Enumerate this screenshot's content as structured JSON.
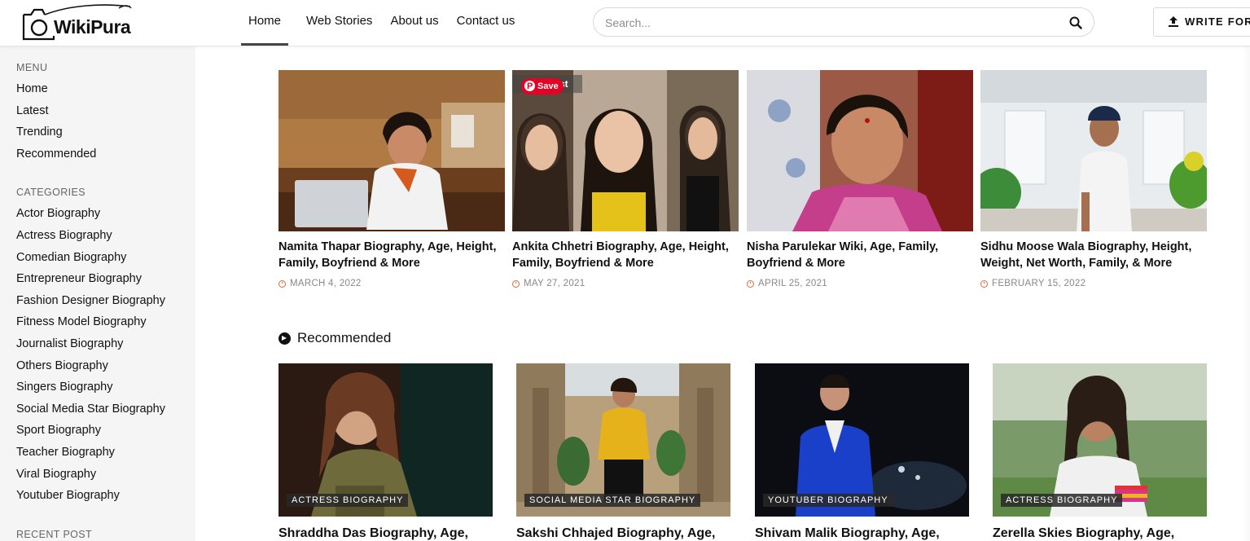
{
  "header": {
    "logo_text": "WikiPura",
    "nav": [
      "Home",
      "Web Stories",
      "About us",
      "Contact us"
    ],
    "search_placeholder": "Search...",
    "write_button": "WRITE FOR"
  },
  "sidebar": {
    "menu_heading": "MENU",
    "menu": [
      "Home",
      "Latest",
      "Trending",
      "Recommended"
    ],
    "categories_heading": "CATEGORIES",
    "categories": [
      "Actor Biography",
      "Actress Biography",
      "Comedian Biography",
      "Entrepreneur Biography",
      "Fashion Designer Biography",
      "Fitness Model Biography",
      "Journalist Biography",
      "Others Biography",
      "Singers Biography",
      "Social Media Star Biography",
      "Sport Biography",
      "Teacher Biography",
      "Viral Biography",
      "Youtuber Biography"
    ],
    "recent_heading": "RECENT POST"
  },
  "top_posts": [
    {
      "title": "Namita Thapar Biography, Age, Height, Family, Boyfriend & More",
      "date": "MARCH 4, 2022"
    },
    {
      "title": "Ankita Chhetri Biography, Age, Height, Family, Boyfriend & More",
      "date": "MAY 27, 2021"
    },
    {
      "title": "Nisha Parulekar Wiki, Age, Family, Boyfriend & More",
      "date": "APRIL 25, 2021"
    },
    {
      "title": "Sidhu Moose Wala Biography, Height, Weight, Net Worth, Family, & More",
      "date": "FEBRUARY 15, 2022"
    }
  ],
  "pin_overlay": {
    "label": "Save",
    "partial_text": "st"
  },
  "recommended": {
    "heading": "Recommended",
    "posts": [
      {
        "tag": "ACTRESS BIOGRAPHY",
        "title": "Shraddha Das Biography, Age,"
      },
      {
        "tag": "SOCIAL MEDIA STAR BIOGRAPHY",
        "title": "Sakshi Chhajed Biography, Age,"
      },
      {
        "tag": "YOUTUBER BIOGRAPHY",
        "title": "Shivam Malik Biography, Age,"
      },
      {
        "tag": "ACTRESS BIOGRAPHY",
        "title": "Zerella Skies Biography, Age,"
      }
    ]
  },
  "colors": {
    "accent": "#e8692b",
    "pinterest": "#e60023",
    "sidebar_bg": "#f5f5f5"
  }
}
